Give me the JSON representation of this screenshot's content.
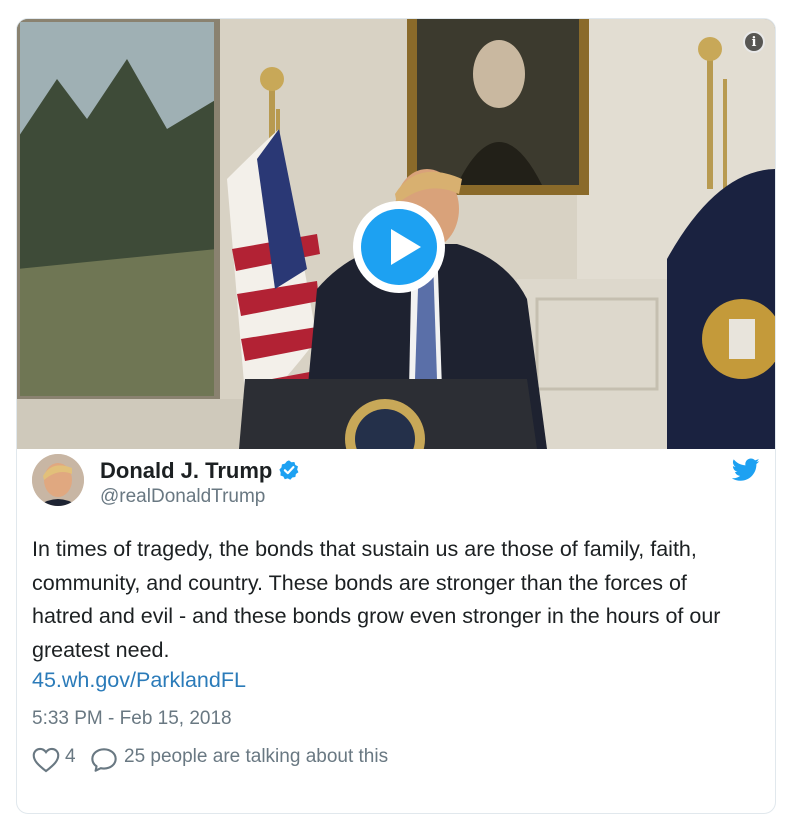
{
  "tweet": {
    "display_name": "Donald J. Trump",
    "handle": "@realDonaldTrump",
    "text": "In times of tragedy, the bonds that sustain us are those of family, faith, community, and country. These bonds are stronger than the forces of hatred and evil - and these bonds grow even stronger in the hours of our greatest need.",
    "link": "45.wh.gov/ParklandFL",
    "timestamp": "5:33 PM - Feb 15, 2018",
    "likes": "4",
    "conversation": "25 people are talking about this"
  },
  "icons": {
    "info": "info-icon",
    "play": "play-icon",
    "verified": "verified-badge-icon",
    "brand": "twitter-bird-icon",
    "like": "heart-icon",
    "reply": "speech-bubble-icon"
  },
  "colors": {
    "accent": "#1da1f2",
    "link": "#2b7bb9",
    "secondary_text": "#697882",
    "primary_text": "#1c2022",
    "border": "#e1e8ed"
  }
}
